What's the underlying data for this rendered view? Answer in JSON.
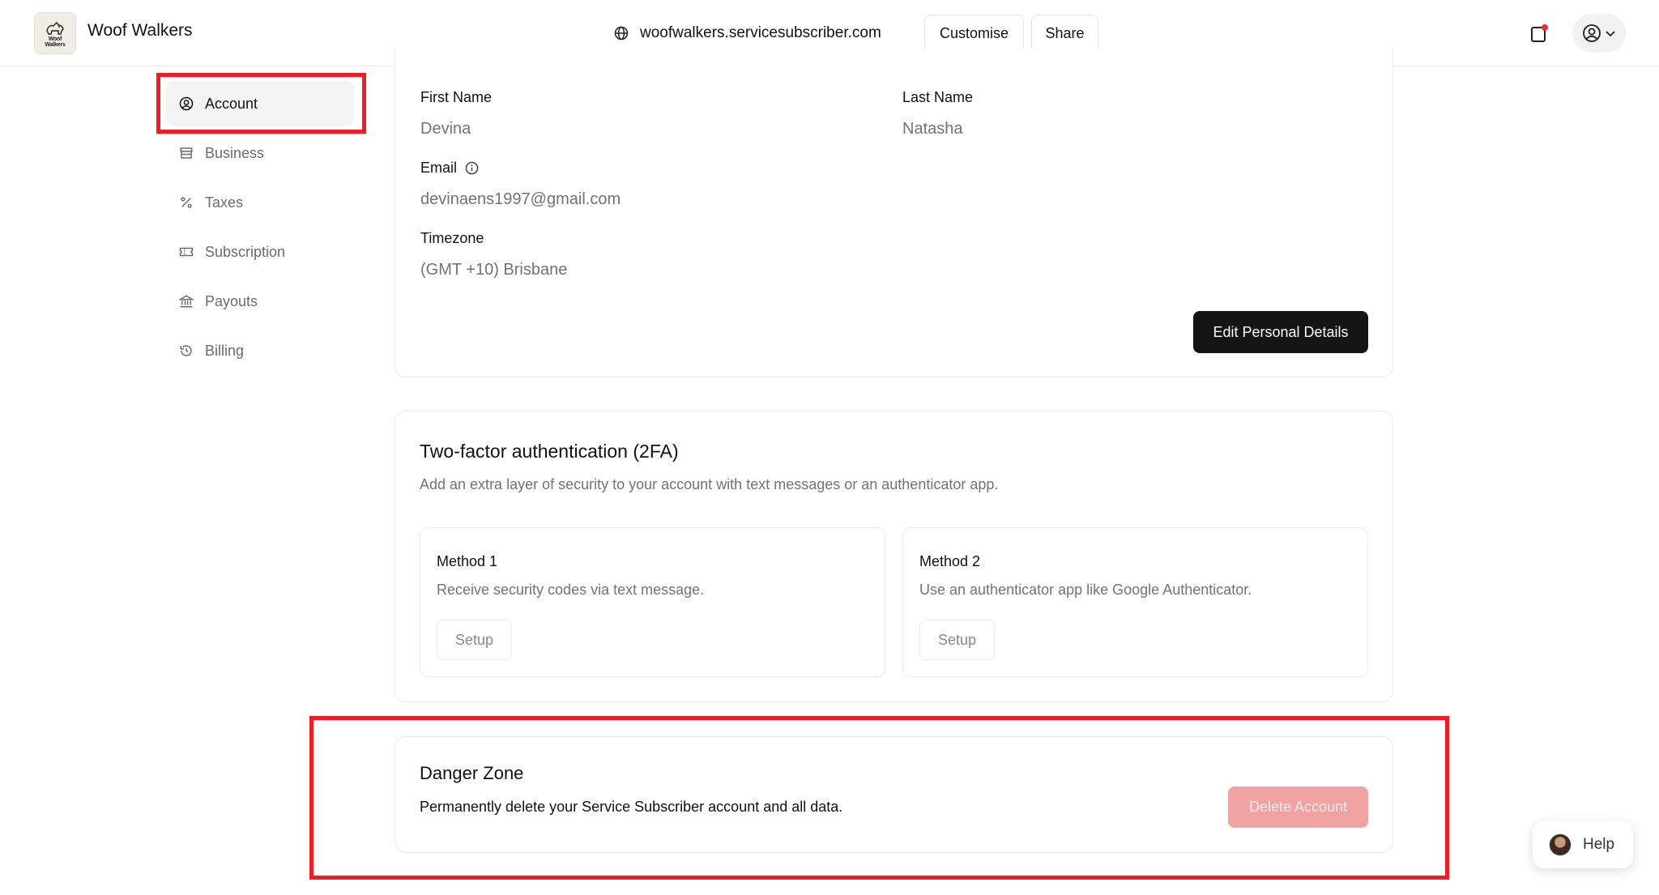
{
  "header": {
    "brand_name": "Woof Walkers",
    "logo_text_line1": "Woof",
    "logo_text_line2": "Walkers",
    "domain": "woofwalkers.servicesubscriber.com",
    "customise_label": "Customise",
    "share_label": "Share",
    "notification_dot_color": "#e5312f"
  },
  "sidebar": {
    "items": [
      {
        "label": "Account",
        "icon": "user-circle-icon",
        "active": true
      },
      {
        "label": "Business",
        "icon": "store-icon"
      },
      {
        "label": "Taxes",
        "icon": "percent-icon"
      },
      {
        "label": "Subscription",
        "icon": "ticket-icon"
      },
      {
        "label": "Payouts",
        "icon": "bank-icon"
      },
      {
        "label": "Billing",
        "icon": "history-icon"
      }
    ]
  },
  "personal": {
    "first_name_label": "First Name",
    "first_name_value": "Devina",
    "last_name_label": "Last Name",
    "last_name_value": "Natasha",
    "email_label": "Email",
    "email_value": "devinaens1997@gmail.com",
    "timezone_label": "Timezone",
    "timezone_value": "(GMT +10) Brisbane",
    "edit_button_label": "Edit Personal Details"
  },
  "two_factor": {
    "title": "Two-factor authentication (2FA)",
    "description": "Add an extra layer of security to your account with text messages or an authenticator app.",
    "methods": [
      {
        "title": "Method 1",
        "description": "Receive security codes via text message.",
        "button_label": "Setup"
      },
      {
        "title": "Method 2",
        "description": "Use an authenticator app like Google Authenticator.",
        "button_label": "Setup"
      }
    ]
  },
  "danger_zone": {
    "title": "Danger Zone",
    "description": "Permanently delete your Service Subscriber account and all data.",
    "delete_button_label": "Delete Account"
  },
  "help": {
    "label": "Help"
  },
  "colors": {
    "highlight": "#ee1c25",
    "primary_button": "#141414",
    "danger_button": "#f1a3a3"
  }
}
